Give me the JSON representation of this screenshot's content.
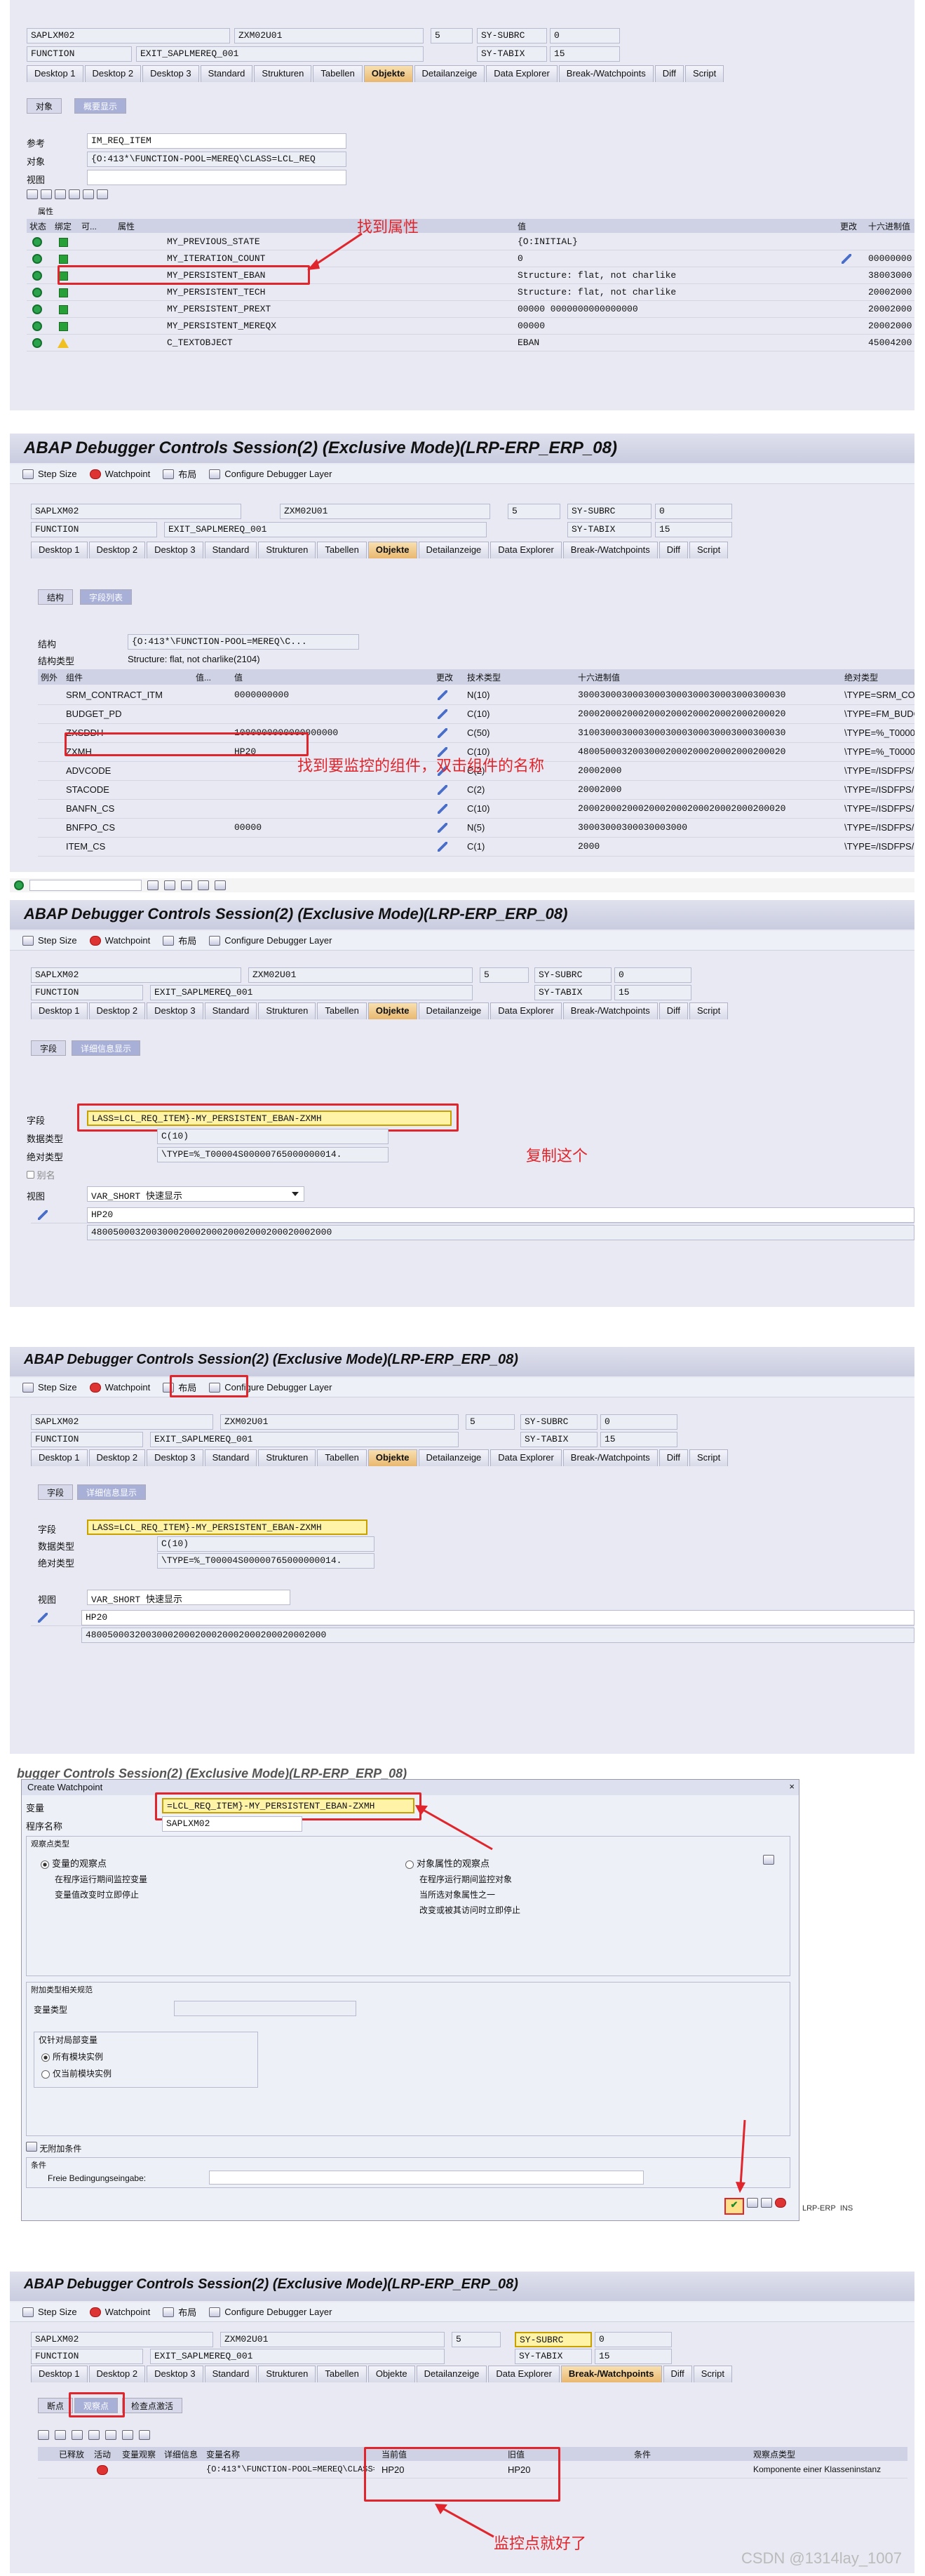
{
  "common": {
    "program": "SAPLXM02",
    "include": "ZXM02U01",
    "line": "5",
    "sy_subrc_label": "SY-SUBRC",
    "sy_subrc_value": "0",
    "event_type": "FUNCTION",
    "event_name": "EXIT_SAPLMEREQ_001",
    "sy_tabix_label": "SY-TABIX",
    "sy_tabix_value": "15",
    "toolbar": {
      "step_size": "Step Size",
      "watchpoint": "Watchpoint",
      "layout": "布局",
      "configure": "Configure Debugger Layer"
    },
    "tabs": [
      "Desktop 1",
      "Desktop 2",
      "Desktop 3",
      "Standard",
      "Strukturen",
      "Tabellen",
      "Objekte",
      "Detailanzeige",
      "Data Explorer",
      "Break-/Watchpoints",
      "Diff",
      "Script"
    ],
    "window_title": "ABAP Debugger Controls Session(2)  (Exclusive Mode)(LRP-ERP_ERP_08)",
    "title_partial": "bugger Controls Session(2) (Exclusive Mode)(LRP-ERP_ERP_08)"
  },
  "s1": {
    "subtabs": [
      "对象",
      "概要显示"
    ],
    "ref_label": "参考",
    "ref_value": "IM_REQ_ITEM",
    "obj_label": "对象",
    "obj_value": "{O:413*\\FUNCTION-POOL=MEREQ\\CLASS=LCL_REQ",
    "view_label": "视图",
    "attr_label": "属性",
    "columns": [
      "状态",
      "绑定",
      "可...",
      "属性",
      "值",
      "更改",
      "十六进制值"
    ],
    "rows": [
      {
        "name": "MY_PREVIOUS_STATE",
        "value": "{O:INITIAL}",
        "hex": ""
      },
      {
        "name": "MY_ITERATION_COUNT",
        "value": "0",
        "hex": "00000000"
      },
      {
        "name": "MY_PERSISTENT_EBAN",
        "value": "Structure: flat, not charlike",
        "hex": "38003000"
      },
      {
        "name": "MY_PERSISTENT_TECH",
        "value": "Structure: flat, not charlike",
        "hex": "20002000"
      },
      {
        "name": "MY_PERSISTENT_PREXT",
        "value": "00000 0000000000000000",
        "hex": "20002000"
      },
      {
        "name": "MY_PERSISTENT_MEREQX",
        "value": "00000",
        "hex": "20002000"
      },
      {
        "name": "C_TEXTOBJECT",
        "value": "EBAN",
        "hex": "45004200"
      }
    ],
    "annotation": "找到属性"
  },
  "s2": {
    "subtabs": [
      "结构",
      "字段列表"
    ],
    "struct_label": "结构",
    "struct_value": "{O:413*\\FUNCTION-POOL=MEREQ\\C...",
    "struct_type_label": "结构类型",
    "struct_type_value": "Structure: flat, not charlike(2104)",
    "columns": [
      "例外",
      "组件",
      "值...",
      "值",
      "更改",
      "技术类型",
      "十六进制值",
      "绝对类型"
    ],
    "rows": [
      {
        "name": "SRM_CONTRACT_ITM",
        "value": "0000000000",
        "tech": "N(10)",
        "hex": "30003000300030003000300030003000300030",
        "abs": "\\TYPE=SRM_CON"
      },
      {
        "name": "BUDGET_PD",
        "value": "",
        "tech": "C(10)",
        "hex": "20002000200020002000200020002000200020",
        "abs": "\\TYPE=FM_BUDG"
      },
      {
        "name": "ZXSDDH",
        "value": "1000000000000000000",
        "tech": "C(50)",
        "hex": "31003000300030003000300030003000300030",
        "abs": "\\TYPE=%_T0000"
      },
      {
        "name": "ZXMH",
        "value": "HP20",
        "tech": "C(10)",
        "hex": "48005000320030002000200020002000200020",
        "abs": "\\TYPE=%_T0000"
      },
      {
        "name": "ADVCODE",
        "value": "",
        "tech": "C(2)",
        "hex": "20002000",
        "abs": "\\TYPE=/ISDFPS/"
      },
      {
        "name": "STACODE",
        "value": "",
        "tech": "C(2)",
        "hex": "20002000",
        "abs": "\\TYPE=/ISDFPS/"
      },
      {
        "name": "BANFN_CS",
        "value": "",
        "tech": "C(10)",
        "hex": "20002000200020002000200020002000200020",
        "abs": "\\TYPE=/ISDFPS/"
      },
      {
        "name": "BNFPO_CS",
        "value": "00000",
        "tech": "N(5)",
        "hex": "30003000300030003000",
        "abs": "\\TYPE=/ISDFPS/"
      },
      {
        "name": "ITEM_CS",
        "value": "",
        "tech": "C(1)",
        "hex": "2000",
        "abs": "\\TYPE=/ISDFPS/"
      }
    ],
    "annotation": "找到要监控的组件，双击组件的名称"
  },
  "s3": {
    "subtabs": [
      "字段",
      "详细信息显示"
    ],
    "field_label": "字段",
    "field_value": "LASS=LCL_REQ_ITEM}-MY_PERSISTENT_EBAN-ZXMH",
    "dtype_label": "数据类型",
    "dtype_value": "C(10)",
    "abs_label": "绝对类型",
    "abs_value": "\\TYPE=%_T00004S00000765000000014.",
    "alias_label": "别名",
    "view_label": "视图",
    "view_value": "VAR_SHORT 快速显示",
    "val": "HP20",
    "hexval": "48005000320030002000200020002000200020002000",
    "annotation": "复制这个"
  },
  "s5": {
    "dialog_title": "Create Watchpoint",
    "var_label": "变量",
    "var_value": "=LCL_REQ_ITEM}-MY_PERSISTENT_EBAN-ZXMH",
    "prog_label": "程序名称",
    "prog_value": "SAPLXM02",
    "wp_type_title": "观察点类型",
    "opt1": "变量的观察点",
    "opt1_desc1": "在程序运行期间监控变量",
    "opt1_desc2": "变量值改变时立即停止",
    "opt2": "对象属性的观察点",
    "opt2_desc1": "在程序运行期间监控对象",
    "opt2_desc2": "当所选对象属性之一",
    "opt2_desc3": "改变或被其访问时立即停止",
    "extra_title": "附加类型相关规范",
    "vartype_label": "变量类型",
    "local_title": "仅针对局部变量",
    "local_opt1": "所有模块实例",
    "local_opt2": "仅当前模块实例",
    "nocond_label": "无附加条件",
    "cond_title": "条件",
    "cond_label": "Freie Bedingungseingabe:",
    "status_sys": "LRP-ERP",
    "status_mode": "INS"
  },
  "s6": {
    "subtabs": [
      "断点",
      "观察点",
      "检查点激活"
    ],
    "columns": [
      "已释放",
      "活动",
      "变量观察",
      "详细信息",
      "变量名称",
      "当前值",
      "旧值",
      "条件",
      "观察点类型"
    ],
    "row": {
      "var": "{O:413*\\FUNCTION-POOL=MEREQ\\CLASS=",
      "cur": "HP20",
      "old": "HP20",
      "cond": "",
      "type": "Komponente einer Klasseninstanz"
    },
    "annotation": "监控点就好了"
  },
  "watermark": "CSDN @1314lay_1007"
}
